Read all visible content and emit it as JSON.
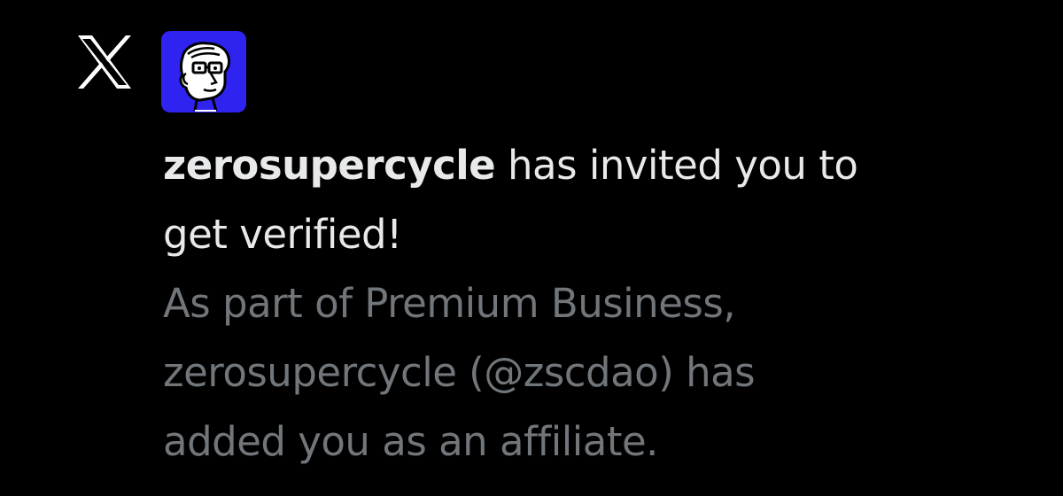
{
  "notification": {
    "app_icon": "x-logo-icon",
    "avatar_icon": "cartoon-face-avatar",
    "accent_color": "#2f23f0",
    "headline": {
      "username": "zerosupercycle",
      "line1_rest": " has invited you to",
      "line2": "get verified!"
    },
    "body": {
      "line1": "As part of Premium Business,",
      "line2": "zerosupercycle (@zscdao) has",
      "line3": "added you as an affiliate."
    }
  }
}
